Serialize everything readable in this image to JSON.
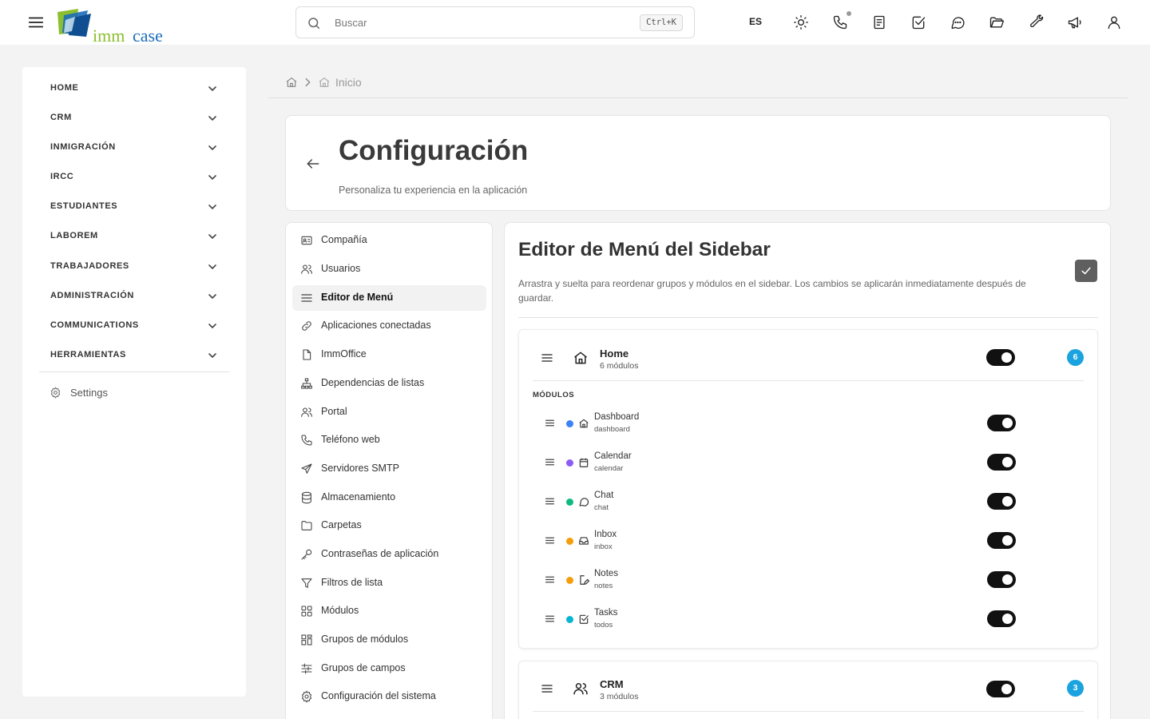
{
  "app": {
    "logo_alt": "imm case",
    "logo_word_1": "imm",
    "logo_word_2": "case"
  },
  "topbar": {
    "search_placeholder": "Buscar",
    "search_shortcut": "Ctrl+K",
    "language": "ES",
    "icons": [
      "sun-icon",
      "phone-icon",
      "notes-icon",
      "tasks-icon",
      "chat-icon",
      "folder-icon",
      "wrench-icon",
      "megaphone-icon",
      "user-icon"
    ]
  },
  "sidebar": {
    "groups": [
      {
        "label": "HOME"
      },
      {
        "label": "CRM"
      },
      {
        "label": "INMIGRACIÓN"
      },
      {
        "label": "IRCC"
      },
      {
        "label": "ESTUDIANTES"
      },
      {
        "label": "LABOREM"
      },
      {
        "label": "TRABAJADORES"
      },
      {
        "label": "ADMINISTRACIÓN"
      },
      {
        "label": "COMMUNICATIONS"
      },
      {
        "label": "HERRAMIENTAS"
      }
    ],
    "settings_label": "Settings"
  },
  "breadcrumb": {
    "current": "Inicio"
  },
  "header": {
    "title": "Configuración",
    "subtitle": "Personaliza tu experiencia en la aplicación"
  },
  "settings_nav": {
    "active": "Editor de Menú",
    "items": [
      {
        "label": "Compañía",
        "icon": "id-card-icon"
      },
      {
        "label": "Usuarios",
        "icon": "users-icon"
      },
      {
        "label": "Editor de Menú",
        "icon": "menu-icon"
      },
      {
        "label": "Aplicaciones conectadas",
        "icon": "link-icon"
      },
      {
        "label": "ImmOffice",
        "icon": "file-icon"
      },
      {
        "label": "Dependencias de listas",
        "icon": "sitemap-icon"
      },
      {
        "label": "Portal",
        "icon": "users-icon"
      },
      {
        "label": "Teléfono web",
        "icon": "phone-icon"
      },
      {
        "label": "Servidores SMTP",
        "icon": "send-icon"
      },
      {
        "label": "Almacenamiento",
        "icon": "database-icon"
      },
      {
        "label": "Carpetas",
        "icon": "folder-icon"
      },
      {
        "label": "Contraseñas de aplicación",
        "icon": "key-icon"
      },
      {
        "label": "Filtros de lista",
        "icon": "filter-icon"
      },
      {
        "label": "Módulos",
        "icon": "grid-icon"
      },
      {
        "label": "Grupos de módulos",
        "icon": "grid-group-icon"
      },
      {
        "label": "Grupos de campos",
        "icon": "sliders-icon"
      },
      {
        "label": "Configuración del sistema",
        "icon": "gear-icon"
      }
    ]
  },
  "editor": {
    "title": "Editor de Menú del Sidebar",
    "description": "Arrastra y suelta para reordenar grupos y módulos en el sidebar. Los cambios se aplicarán inmediatamente después de guardar.",
    "modules_label": "MÓDULOS",
    "groups": [
      {
        "name": "Home",
        "count_text": "6 módulos",
        "badge": "6",
        "enabled": true,
        "modules": [
          {
            "name": "Dashboard",
            "key": "dashboard",
            "color": "#3b82f6",
            "icon": "home-icon",
            "enabled": true
          },
          {
            "name": "Calendar",
            "key": "calendar",
            "color": "#8b5cf6",
            "icon": "calendar-icon",
            "enabled": true
          },
          {
            "name": "Chat",
            "key": "chat",
            "color": "#10b981",
            "icon": "chat-icon",
            "enabled": true
          },
          {
            "name": "Inbox",
            "key": "inbox",
            "color": "#f59e0b",
            "icon": "inbox-icon",
            "enabled": true
          },
          {
            "name": "Notes",
            "key": "notes",
            "color": "#f59e0b",
            "icon": "pencil-icon",
            "enabled": true
          },
          {
            "name": "Tasks",
            "key": "todos",
            "color": "#06b6d4",
            "icon": "checkbox-icon",
            "enabled": true
          }
        ]
      },
      {
        "name": "CRM",
        "count_text": "3 módulos",
        "badge": "3",
        "enabled": true,
        "modules": []
      }
    ]
  }
}
